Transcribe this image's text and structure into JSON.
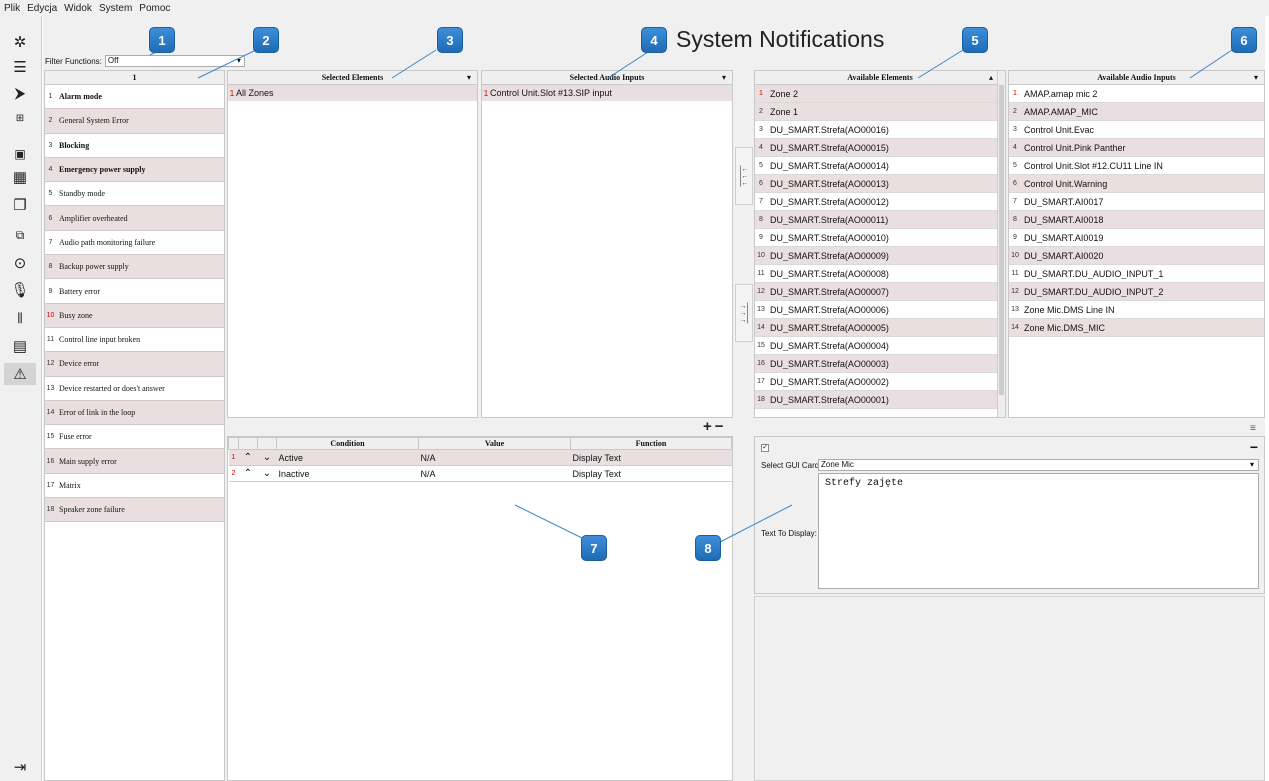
{
  "menu": [
    "Plik",
    "Edycja",
    "Widok",
    "System",
    "Pomoc"
  ],
  "sidebar_icons": [
    "gear-icon",
    "server-icon",
    "routing-icon",
    "matrix-icon",
    "blocks-icon",
    "grid-icon",
    "windows-icon",
    "device-icon",
    "gauge-icon",
    "microphone-icon",
    "mixer-icon",
    "document-icon",
    "warning-icon"
  ],
  "logout_icon": "logout-icon",
  "filter": {
    "label": "Filter Functions:",
    "value": "Off"
  },
  "title": "System Notifications",
  "list_header": "1",
  "notifications": [
    {
      "num": "1",
      "label": "Alarm mode"
    },
    {
      "num": "2",
      "label": "General System Error"
    },
    {
      "num": "3",
      "label": "Blocking"
    },
    {
      "num": "4",
      "label": "Emergency power supply"
    },
    {
      "num": "5",
      "label": "Standby mode"
    },
    {
      "num": "6",
      "label": "Amplifier overheated"
    },
    {
      "num": "7",
      "label": "Audio path monitoring failure"
    },
    {
      "num": "8",
      "label": "Backup power supply"
    },
    {
      "num": "9",
      "label": "Battery error"
    },
    {
      "num": "10",
      "label": "Busy zone"
    },
    {
      "num": "11",
      "label": "Control line input broken"
    },
    {
      "num": "12",
      "label": "Device error"
    },
    {
      "num": "13",
      "label": "Device restarted or does't answer"
    },
    {
      "num": "14",
      "label": "Error of link in the loop"
    },
    {
      "num": "15",
      "label": "Fuse error"
    },
    {
      "num": "16",
      "label": "Main supply error"
    },
    {
      "num": "17",
      "label": "Matrix"
    },
    {
      "num": "18",
      "label": "Speaker zone failure"
    }
  ],
  "selected_elements": {
    "header": "Selected Elements",
    "rows": [
      {
        "num": "1",
        "label": "All Zones"
      }
    ]
  },
  "selected_audio": {
    "header": "Selected Audio Inputs",
    "rows": [
      {
        "num": "1",
        "label": "Control Unit.Slot #13.SIP input"
      }
    ]
  },
  "available_elements": {
    "header": "Available Elements",
    "rows": [
      {
        "num": "1",
        "label": "Zone 2"
      },
      {
        "num": "2",
        "label": "Zone 1"
      },
      {
        "num": "3",
        "label": "DU_SMART.Strefa(AO00016)"
      },
      {
        "num": "4",
        "label": "DU_SMART.Strefa(AO00015)"
      },
      {
        "num": "5",
        "label": "DU_SMART.Strefa(AO00014)"
      },
      {
        "num": "6",
        "label": "DU_SMART.Strefa(AO00013)"
      },
      {
        "num": "7",
        "label": "DU_SMART.Strefa(AO00012)"
      },
      {
        "num": "8",
        "label": "DU_SMART.Strefa(AO00011)"
      },
      {
        "num": "9",
        "label": "DU_SMART.Strefa(AO00010)"
      },
      {
        "num": "10",
        "label": "DU_SMART.Strefa(AO00009)"
      },
      {
        "num": "11",
        "label": "DU_SMART.Strefa(AO00008)"
      },
      {
        "num": "12",
        "label": "DU_SMART.Strefa(AO00007)"
      },
      {
        "num": "13",
        "label": "DU_SMART.Strefa(AO00006)"
      },
      {
        "num": "14",
        "label": "DU_SMART.Strefa(AO00005)"
      },
      {
        "num": "15",
        "label": "DU_SMART.Strefa(AO00004)"
      },
      {
        "num": "16",
        "label": "DU_SMART.Strefa(AO00003)"
      },
      {
        "num": "17",
        "label": "DU_SMART.Strefa(AO00002)"
      },
      {
        "num": "18",
        "label": "DU_SMART.Strefa(AO00001)"
      }
    ]
  },
  "available_audio": {
    "header": "Available Audio Inputs",
    "rows": [
      {
        "num": "1",
        "label": "AMAP.amap mic 2"
      },
      {
        "num": "2",
        "label": "AMAP.AMAP_MIC"
      },
      {
        "num": "3",
        "label": "Control Unit.Evac"
      },
      {
        "num": "4",
        "label": "Control Unit.Pink Panther"
      },
      {
        "num": "5",
        "label": "Control Unit.Slot #12.CU11 Line IN"
      },
      {
        "num": "6",
        "label": "Control Unit.Warning"
      },
      {
        "num": "7",
        "label": "DU_SMART.AI0017"
      },
      {
        "num": "8",
        "label": "DU_SMART.AI0018"
      },
      {
        "num": "9",
        "label": "DU_SMART.AI0019"
      },
      {
        "num": "10",
        "label": "DU_SMART.AI0020"
      },
      {
        "num": "11",
        "label": "DU_SMART.DU_AUDIO_INPUT_1"
      },
      {
        "num": "12",
        "label": "DU_SMART.DU_AUDIO_INPUT_2"
      },
      {
        "num": "13",
        "label": "Zone Mic.DMS Line IN"
      },
      {
        "num": "14",
        "label": "Zone Mic.DMS_MIC"
      }
    ]
  },
  "conditions": {
    "headers": [
      "Condition",
      "Value",
      "Function"
    ],
    "rows": [
      {
        "num": "1",
        "condition": "Active",
        "value": "N/A",
        "function": "Display Text"
      },
      {
        "num": "2",
        "condition": "Inactive",
        "value": "N/A",
        "function": "Display Text"
      }
    ]
  },
  "gui": {
    "select_label": "Select GUI Card:",
    "select_value": "Zone Mic",
    "text_label": "Text To Display:",
    "text_value": "Strefy zajęte"
  },
  "callouts": [
    "1",
    "2",
    "3",
    "4",
    "5",
    "6",
    "7",
    "8"
  ]
}
